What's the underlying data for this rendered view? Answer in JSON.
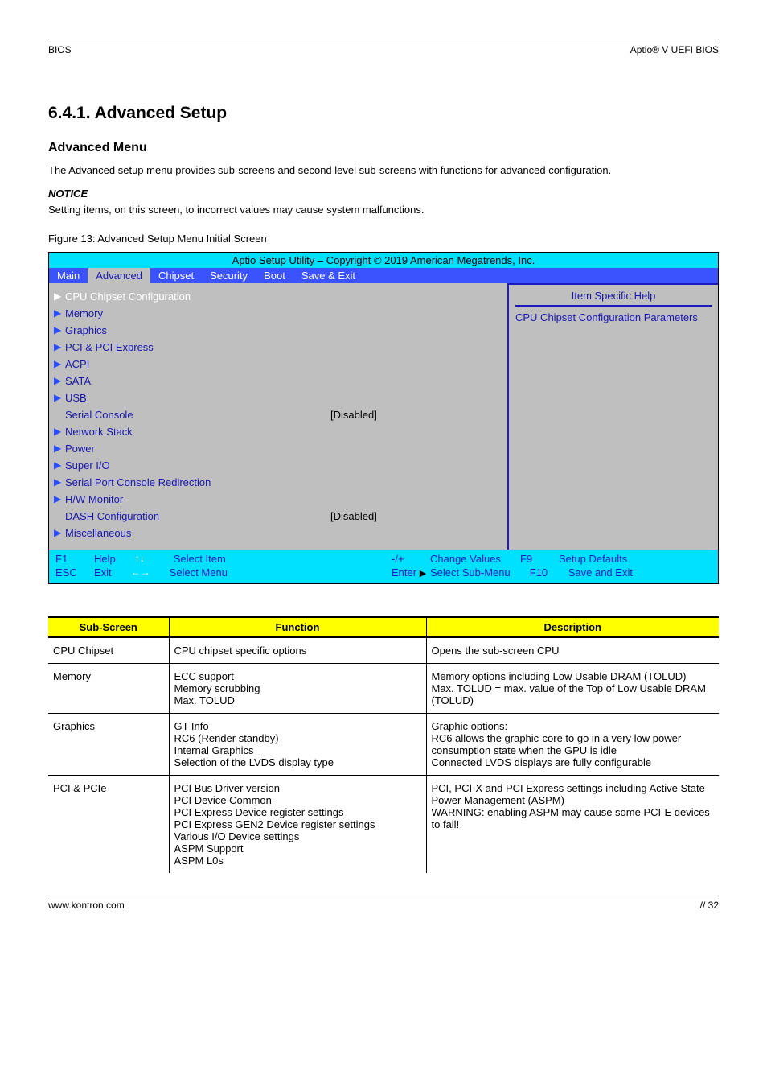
{
  "header": {
    "left": "BIOS",
    "right": "Aptio® V UEFI BIOS"
  },
  "section": {
    "title": "6.4.1. Advanced Setup",
    "sub": "Advanced Menu",
    "desc": "The Advanced setup menu provides sub-screens and second level sub-screens with functions for advanced configuration."
  },
  "note": {
    "label": "NOTICE",
    "text": "Setting items, on this screen, to incorrect values may cause system malfunctions."
  },
  "figure_caption": "Figure 13: Advanced Setup Menu Initial Screen",
  "bios": {
    "util_title": "Aptio Setup Utility – Copyright © 2019 American Megatrends, Inc.",
    "tabs": [
      "Main",
      "Advanced",
      "Chipset",
      "Security",
      "Boot",
      "Save & Exit"
    ],
    "active_tab": "Advanced",
    "left_items": [
      {
        "label": "CPU Chipset Configuration",
        "selected": true
      },
      {
        "label": "Memory",
        "selected": false
      },
      {
        "label": "Graphics",
        "selected": false
      },
      {
        "label": "PCI & PCI Express",
        "selected": false
      },
      {
        "label": "ACPI",
        "selected": false
      },
      {
        "label": "SATA",
        "selected": false
      },
      {
        "label": "USB",
        "selected": false
      }
    ],
    "left_values": [
      {
        "label": "Serial Console",
        "value": "[Disabled]"
      }
    ],
    "left_more": [
      {
        "label": "Network Stack"
      },
      {
        "label": "Power"
      },
      {
        "label": "Super I/O"
      },
      {
        "label": "Serial Port Console Redirection"
      },
      {
        "label": "H/W Monitor",
        "value": ""
      }
    ],
    "left_values2": [
      {
        "label": "DASH Configuration",
        "value": "[Disabled]"
      }
    ],
    "left_bottom": [
      {
        "label": "Miscellaneous"
      }
    ],
    "help_title": "Item Specific Help",
    "help_body": "CPU Chipset Configuration Parameters",
    "footer": [
      {
        "key": "F1",
        "text": "Help"
      },
      {
        "key": "↑↓",
        "text": "Select Item",
        "arrows": "vert"
      },
      {
        "key": "-/+",
        "text": "Change Values"
      },
      {
        "key": "F9",
        "text": "Setup Defaults"
      },
      {
        "key": "ESC",
        "text": "Exit"
      },
      {
        "key": "←→",
        "text": "Select Menu",
        "arrows": "horiz"
      },
      {
        "key": "Enter ▶",
        "text": "Select Sub-Menu",
        "tri": true
      },
      {
        "key": "F10",
        "text": "Save and Exit"
      }
    ]
  },
  "table": {
    "headers": [
      "Sub-Screen",
      "Function",
      "Description"
    ],
    "rows": [
      {
        "s": "CPU Chipset",
        "f": "CPU chipset specific options",
        "d": "Opens the sub-screen CPU"
      },
      {
        "s": "Memory",
        "f": "ECC support\nMemory scrubbing\nMax. TOLUD",
        "d": "Memory options including Low Usable DRAM (TOLUD)\nMax. TOLUD = max. value of the Top of Low Usable DRAM (TOLUD)"
      },
      {
        "s": "Graphics",
        "f": "GT Info\nRC6 (Render standby)\nInternal Graphics\nSelection of the LVDS display type",
        "d": "Graphic options:\nRC6 allows the graphic-core to go in a very low power consumption state when the GPU is idle\nConnected LVDS displays are fully configurable"
      },
      {
        "s": "PCI & PCIe",
        "f": "PCI Bus Driver version\nPCI Device Common\nPCI Express Device register settings\nPCI Express GEN2 Device register settings\nVarious I/O Device settings\nASPM Support\nASPM L0s",
        "d": "PCI, PCI-X and PCI Express settings including Active State Power Management (ASPM)\nWARNING: enabling ASPM may cause some PCI-E devices to fail!"
      }
    ]
  },
  "footer": {
    "left": "www.kontron.com",
    "right": "// 32"
  }
}
